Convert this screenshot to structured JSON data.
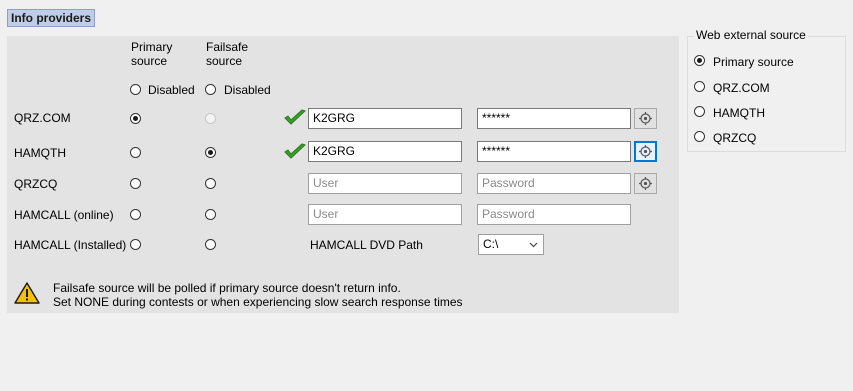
{
  "section_title": "Info providers",
  "columns": {
    "primary": [
      "Primary",
      "source"
    ],
    "failsafe": [
      "Failsafe",
      "source"
    ],
    "disabled_label": "Disabled"
  },
  "providers": {
    "qrz": {
      "name": "QRZ.COM",
      "user": "K2GRG",
      "password": "******"
    },
    "hamqth": {
      "name": "HAMQTH",
      "user": "K2GRG",
      "password": "******"
    },
    "qrzcq": {
      "name": "QRZCQ",
      "user_placeholder": "User",
      "password_placeholder": "Password"
    },
    "hamcall_online": {
      "name": "HAMCALL (online)",
      "user_placeholder": "User",
      "password_placeholder": "Password"
    },
    "hamcall_installed": {
      "name": "HAMCALL (Installed)",
      "dvd_label": "HAMCALL DVD Path",
      "dvd_value": "C:\\"
    }
  },
  "note": {
    "line1": "Failsafe source will be polled if primary source doesn't return info.",
    "line2": "Set NONE during contests or when experiencing slow search response times"
  },
  "web_source": {
    "title": "Web external source",
    "options": [
      "Primary source",
      "QRZ.COM",
      "HAMQTH",
      "QRZCQ"
    ],
    "selected": "Primary source"
  },
  "selection": {
    "primary": "QRZ.COM",
    "failsafe": "HAMQTH"
  },
  "colors": {
    "check": "#3aa12a",
    "title_bg": "#c0cde6",
    "focus": "#0078d7",
    "warning": "#f2c200"
  },
  "icons": [
    "check-icon",
    "gear-icon",
    "warning-icon",
    "chevron-down-icon"
  ]
}
